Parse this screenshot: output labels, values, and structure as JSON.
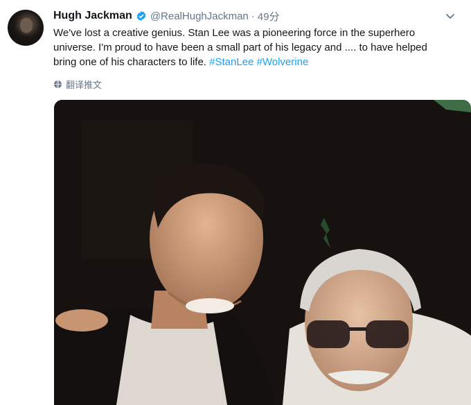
{
  "tweet": {
    "author_name": "Hugh Jackman",
    "handle": "@RealHughJackman",
    "separator": "·",
    "time": "49分",
    "text_parts": [
      "We've lost a creative genius. Stan Lee was a pioneering force in the superhero universe. I'm proud to have been a small part of his legacy and .... to have helped bring one of his characters to life. ",
      "#StanLee",
      " ",
      "#Wolverine"
    ],
    "translate_label": "翻译推文"
  },
  "colors": {
    "link": "#1da1f2",
    "verified": "#1da1f2",
    "text": "#14171a",
    "secondary": "#657786"
  },
  "icons": [
    "verified-badge-icon",
    "chevron-down-icon",
    "globe-icon"
  ]
}
